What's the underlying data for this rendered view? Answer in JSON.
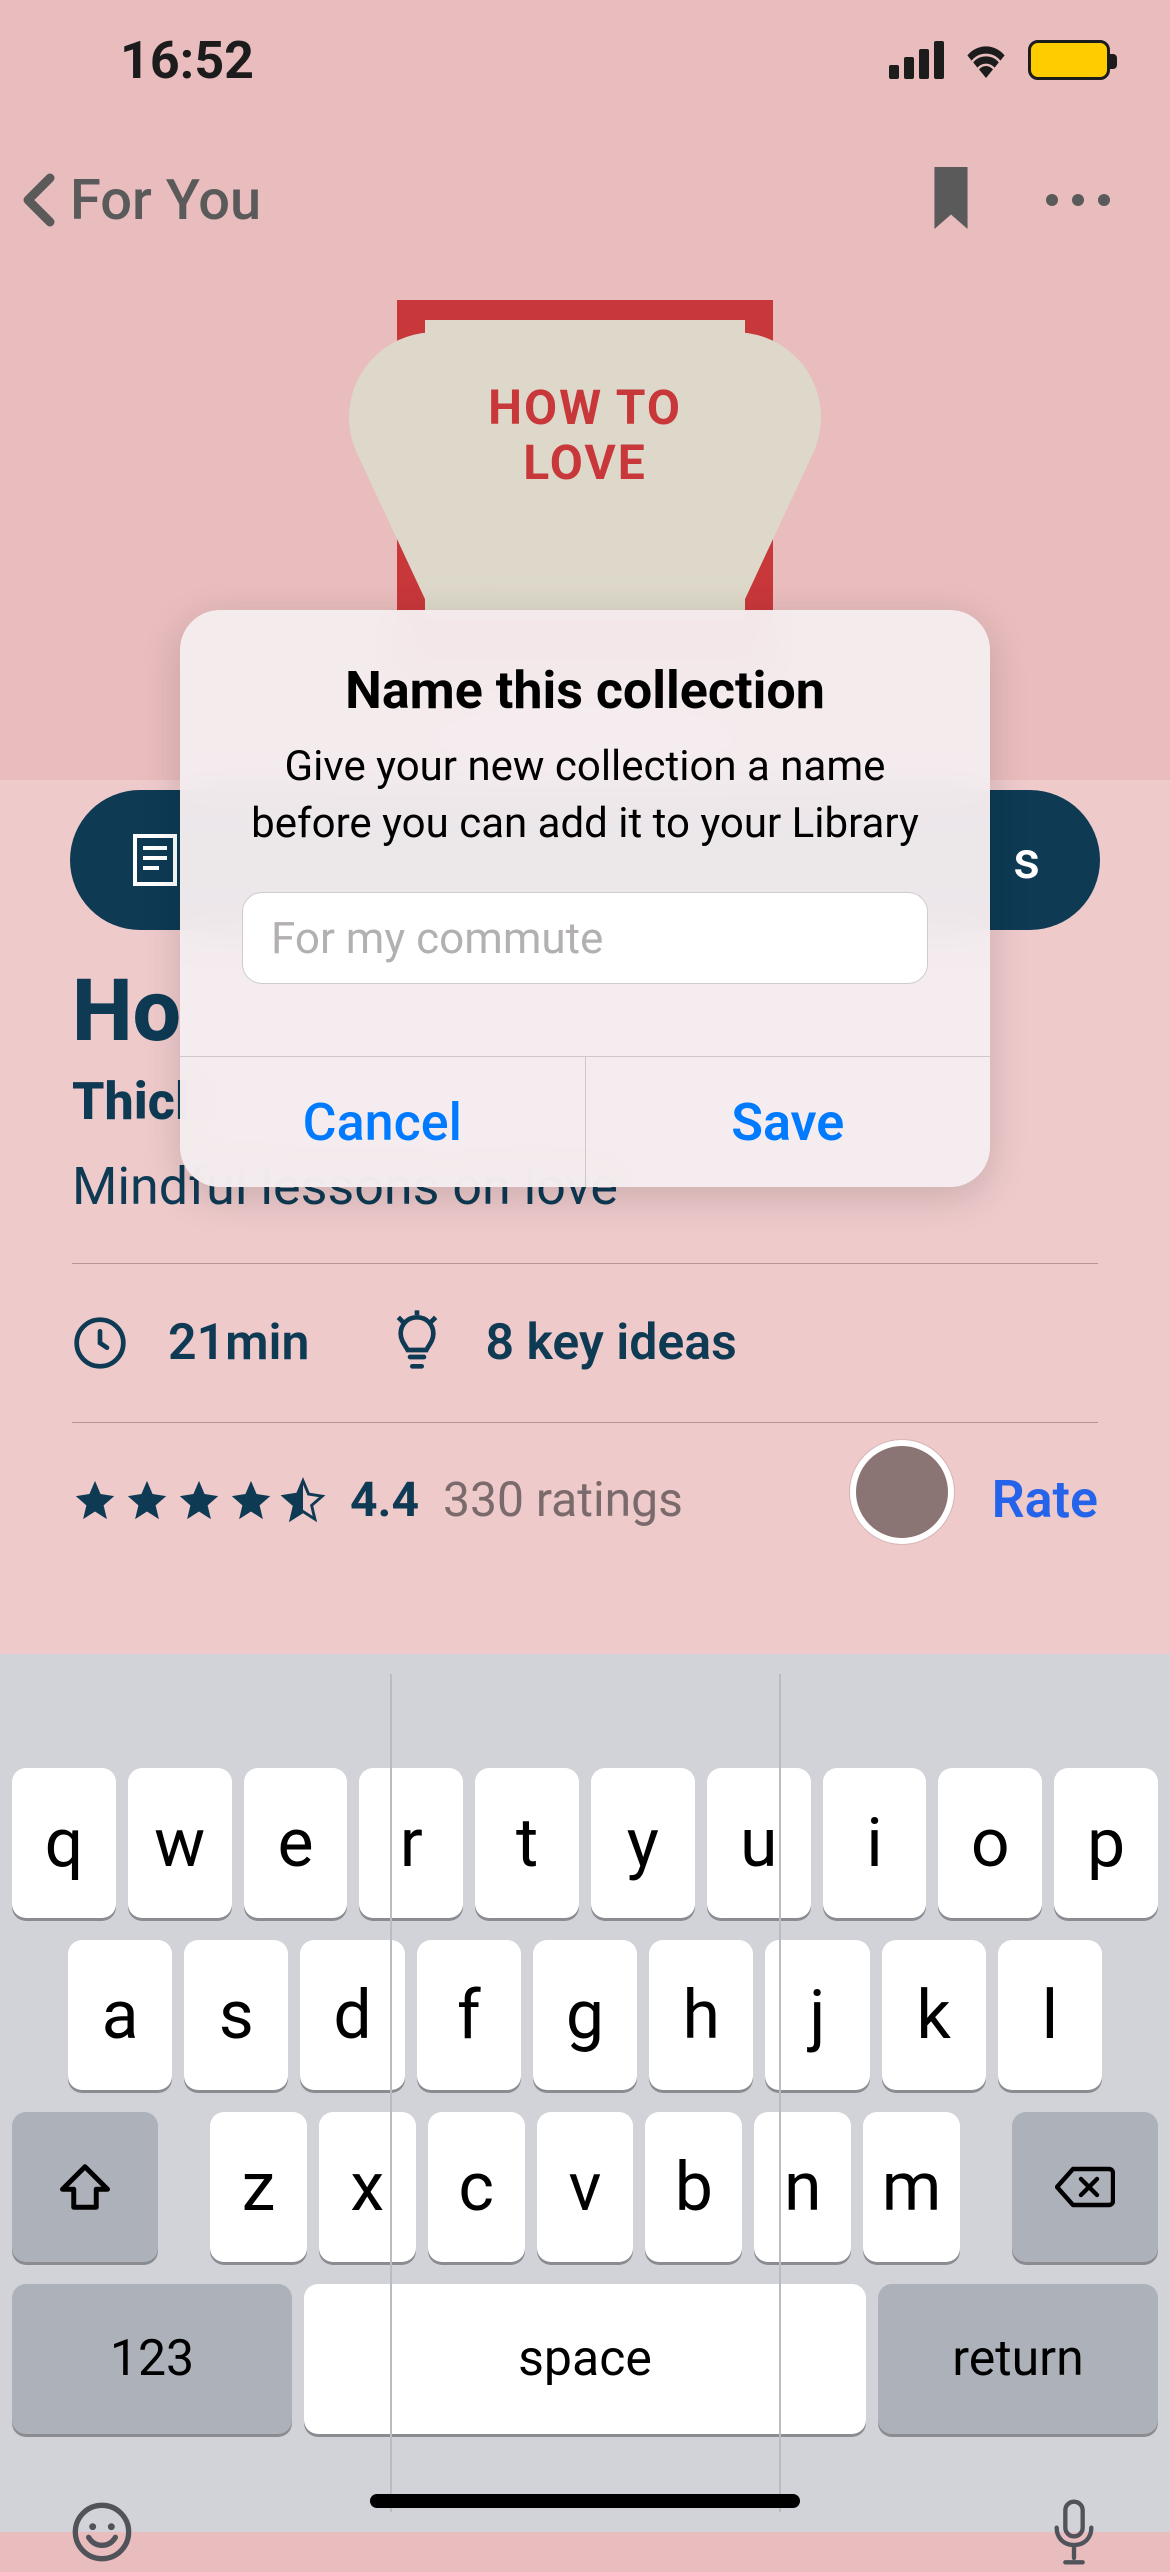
{
  "status": {
    "time": "16:52"
  },
  "nav": {
    "back_label": "For You"
  },
  "cover": {
    "line1": "HOW TO",
    "line2": "LOVE"
  },
  "pill": {
    "trailing": "s"
  },
  "book": {
    "title": "Ho",
    "author": "Thicl",
    "subtitle": "Mindful lessons on love"
  },
  "meta": {
    "duration": "21min",
    "ideas": "8 key ideas"
  },
  "rating": {
    "score": "4.4",
    "count": "330 ratings",
    "rate_label": "Rate"
  },
  "modal": {
    "title": "Name this collection",
    "subtitle": "Give your new collection a name before you can add it to your Library",
    "placeholder": "For my commute",
    "cancel": "Cancel",
    "save": "Save"
  },
  "keyboard": {
    "row1": [
      "q",
      "w",
      "e",
      "r",
      "t",
      "y",
      "u",
      "i",
      "o",
      "p"
    ],
    "row2": [
      "a",
      "s",
      "d",
      "f",
      "g",
      "h",
      "j",
      "k",
      "l"
    ],
    "row3": [
      "z",
      "x",
      "c",
      "v",
      "b",
      "n",
      "m"
    ],
    "numbers": "123",
    "space": "space",
    "return": "return"
  }
}
